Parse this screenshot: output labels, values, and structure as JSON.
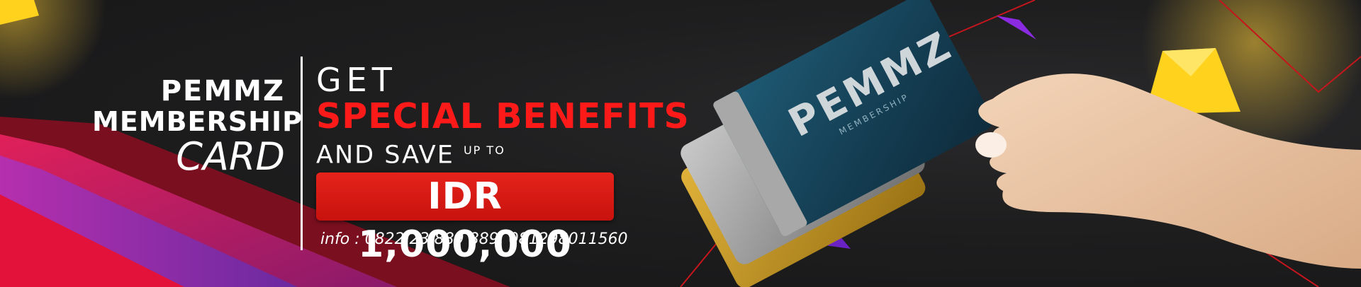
{
  "brand": {
    "logo": "PEMMZ",
    "line2": "MEMBERSHIP",
    "line3": "CARD"
  },
  "offer": {
    "line1": "GET",
    "line2": "SPECIAL BENEFITS",
    "line3": "AND SAVE",
    "line3_suffix": "UP TO",
    "amount": "IDR 1,000,000"
  },
  "contact": {
    "info": "info : 0822 23 889 889, 081298011560"
  },
  "card": {
    "logo": "PEMMZ",
    "sub": "MEMBERSHIP"
  },
  "colors": {
    "accent_red": "#ff1a1a",
    "box_red": "#d4160f",
    "yellow": "#ffd21e",
    "purple": "#7b2ad9",
    "background": "#1b1b1c"
  }
}
